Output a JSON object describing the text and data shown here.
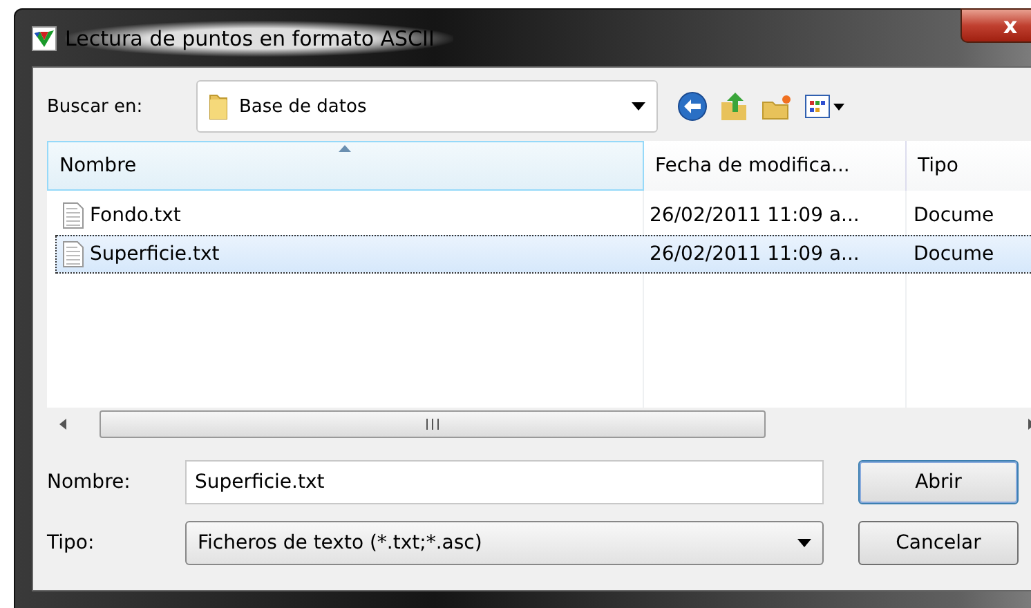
{
  "window": {
    "title": "Lectura de puntos en formato ASCII",
    "close": "x"
  },
  "look_in": {
    "label": "Buscar en:",
    "value": "Base de datos"
  },
  "table": {
    "columns": [
      {
        "label": "Nombre",
        "sorted": true
      },
      {
        "label": "Fecha de modifica...",
        "sorted": false
      },
      {
        "label": "Tipo",
        "sorted": false
      }
    ],
    "rows": [
      {
        "cells": [
          "Fondo.txt",
          "26/02/2011 11:09 a...",
          "Docume"
        ],
        "selected": false
      },
      {
        "cells": [
          "Superficie.txt",
          "26/02/2011 11:09 a...",
          "Docume"
        ],
        "selected": true
      }
    ]
  },
  "file_name": {
    "label": "Nombre:",
    "value": "Superficie.txt"
  },
  "file_type": {
    "label": "Tipo:",
    "value": "Ficheros de texto (*.txt;*.asc)"
  },
  "buttons": [
    "Abrir",
    "Cancelar"
  ]
}
